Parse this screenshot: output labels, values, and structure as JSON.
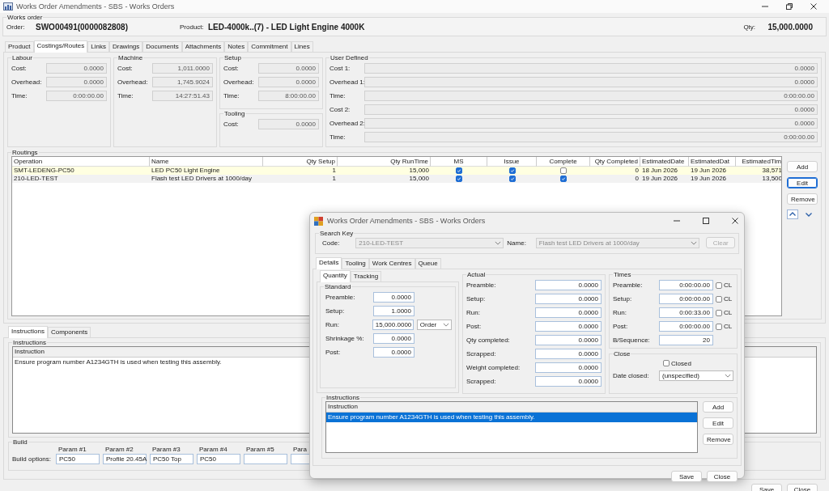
{
  "window": {
    "title": "Works Order Amendments - SBS - Works Orders"
  },
  "works_order": {
    "title": "Works order",
    "order_label": "Order:",
    "order": "SWO00491(0000082808)",
    "product_label": "Product:",
    "product": "LED-4000k..(7) - LED Light Engine 4000K",
    "qty_label": "Qty:",
    "qty": "15,000.0000"
  },
  "tabs": [
    {
      "label": "Product",
      "selected": false
    },
    {
      "label": "Costings/Routes",
      "selected": true
    },
    {
      "label": "Links",
      "selected": false
    },
    {
      "label": "Drawings",
      "selected": false
    },
    {
      "label": "Documents",
      "selected": false
    },
    {
      "label": "Attachments",
      "selected": false
    },
    {
      "label": "Notes",
      "selected": false
    },
    {
      "label": "Commitment",
      "selected": false
    },
    {
      "label": "Lines",
      "selected": false
    }
  ],
  "cost_columns": [
    {
      "groups": [
        {
          "title": "Labour",
          "fields": [
            {
              "label": "Cost:",
              "value": "0.0000"
            },
            {
              "label": "Overhead:",
              "value": "0.0000"
            },
            {
              "label": "Time:",
              "value": "0:00:00.00"
            }
          ]
        }
      ]
    },
    {
      "groups": [
        {
          "title": "Machine",
          "fields": [
            {
              "label": "Cost:",
              "value": "1,011.0000"
            },
            {
              "label": "Overhead:",
              "value": "1,745.9024"
            },
            {
              "label": "Time:",
              "value": "14:27:51.43"
            }
          ]
        }
      ]
    },
    {
      "groups": [
        {
          "title": "Setup",
          "fields": [
            {
              "label": "Cost:",
              "value": "0.0000"
            },
            {
              "label": "Overhead:",
              "value": "0.0000"
            },
            {
              "label": "Time:",
              "value": "8:00:00.00"
            }
          ]
        },
        {
          "title": "Tooling",
          "fields": [
            {
              "label": "Cost:",
              "value": "0.0000"
            }
          ]
        }
      ]
    },
    {
      "groups": [
        {
          "title": "User Defined",
          "fields": [
            {
              "label": "Cost 1:",
              "value": "0.0000"
            },
            {
              "label": "Overhead 1:",
              "value": "0.0000"
            },
            {
              "label": "Time:",
              "value": "0:00:00.00"
            },
            {
              "label": "Cost 2:",
              "value": "0.0000"
            },
            {
              "label": "Overhead 2:",
              "value": "0.0000"
            },
            {
              "label": "Time:",
              "value": "0:00:00.00"
            }
          ]
        }
      ]
    }
  ],
  "routings": {
    "title": "Routings",
    "columns": [
      {
        "label": "Operation",
        "kind": "text"
      },
      {
        "label": "Name",
        "kind": "text"
      },
      {
        "label": "Qty Setup",
        "kind": "number"
      },
      {
        "label": "Qty RunTime",
        "kind": "number"
      },
      {
        "label": "MS",
        "kind": "check"
      },
      {
        "label": "Issue",
        "kind": "check"
      },
      {
        "label": "Complete",
        "kind": "check"
      },
      {
        "label": "Qty Completed",
        "kind": "number"
      },
      {
        "label": "EstimatedDate",
        "kind": "text"
      },
      {
        "label": "EstimatedDat",
        "kind": "text"
      },
      {
        "label": "EstimatedTim",
        "kind": "number"
      }
    ],
    "rows": [
      {
        "selected": true,
        "cells": [
          "SMT-LEDENG-PC50",
          "LED PC50 Light Engine",
          "1",
          "15,000",
          true,
          true,
          false,
          "0",
          "18 Jun 2026",
          "19 Jun 2026",
          "38,571"
        ]
      },
      {
        "selected": false,
        "cells": [
          "210-LED-TEST",
          "Flash test LED Drivers at 1000/day",
          "1",
          "15,000",
          true,
          true,
          true,
          "0",
          "19 Jun 2026",
          "19 Jun 2026",
          "13,500"
        ]
      }
    ],
    "buttons": [
      {
        "label": "Add",
        "focused": false
      },
      {
        "label": "Edit",
        "focused": true
      },
      {
        "label": "Remove",
        "focused": false
      }
    ]
  },
  "lower_tabs": [
    {
      "label": "Instructions",
      "selected": true
    },
    {
      "label": "Components",
      "selected": false
    }
  ],
  "instructions": {
    "title": "Instructions",
    "column": "Instruction",
    "rows": [
      {
        "text": "Ensure program number A1234GTH is used when testing this assembly.",
        "selected": false
      }
    ]
  },
  "build": {
    "title": "Build",
    "label": "Build options:",
    "params": [
      {
        "label": "Param #1",
        "value": "PC50"
      },
      {
        "label": "Param #2",
        "value": "Profile 20.45A"
      },
      {
        "label": "Param #3",
        "value": "PC50 Top"
      },
      {
        "label": "Param #4",
        "value": "PC50"
      },
      {
        "label": "Param #5"
      },
      {
        "label": "Para"
      }
    ]
  },
  "footer_buttons": [
    "Save",
    "Close"
  ],
  "dialog": {
    "title": "Works Order Amendments - SBS - Works Orders",
    "search_key": {
      "title": "Search Key",
      "code_label": "Code:",
      "code": "210-LED-TEST",
      "name_label": "Name:",
      "name": "Flash test LED Drivers at 1000/day",
      "clear": "Clear",
      "clear_disabled": true
    },
    "tabs": [
      {
        "label": "Details",
        "selected": true
      },
      {
        "label": "Tooling",
        "selected": false
      },
      {
        "label": "Work Centres",
        "selected": false
      },
      {
        "label": "Queue",
        "selected": false
      }
    ],
    "subtabs": [
      {
        "label": "Quantity",
        "selected": true
      },
      {
        "label": "Tracking",
        "selected": false
      }
    ],
    "standard": {
      "title": "Standard",
      "fields": [
        {
          "label": "Preamble:",
          "value": "0.0000"
        },
        {
          "label": "Setup:",
          "value": "1.0000"
        },
        {
          "label": "Run:",
          "value": "15,000.0000",
          "unit": "Order"
        },
        {
          "label": "Shrinkage %:",
          "value": "0.0000"
        },
        {
          "label": "Post:",
          "value": "0.0000"
        }
      ]
    },
    "actual": {
      "title": "Actual",
      "fields": [
        {
          "label": "Preamble:",
          "value": "0.0000"
        },
        {
          "label": "Setup:",
          "value": "0.0000"
        },
        {
          "label": "Run:",
          "value": "0.0000"
        },
        {
          "label": "Post:",
          "value": "0.0000"
        },
        {
          "label": "Qty completed:",
          "value": "0.0000"
        },
        {
          "label": "Scrapped:",
          "value": "0.0000"
        },
        {
          "label": "Weight completed:",
          "value": "0.0000"
        },
        {
          "label": "Scrapped:",
          "value": "0.0000"
        }
      ]
    },
    "times": {
      "title": "Times",
      "fields": [
        {
          "label": "Preamble:",
          "value": "0:00:00.00",
          "cl_label": "CL",
          "cl": false
        },
        {
          "label": "Setup:",
          "value": "0:00:00.00",
          "cl_label": "CL",
          "cl": false
        },
        {
          "label": "Run:",
          "value": "0:00:33.00",
          "cl_label": "CL",
          "cl": false
        },
        {
          "label": "Post:",
          "value": "0:00:00.00",
          "cl_label": "CL",
          "cl": false
        },
        {
          "label": "B/Sequence:",
          "value": "20"
        }
      ]
    },
    "close": {
      "title": "Close",
      "closed_label": "Closed",
      "closed": false,
      "date_label": "Date closed:",
      "date": "(unspecified)"
    },
    "instructions": {
      "title": "Instructions",
      "column": "Instruction",
      "rows": [
        {
          "text": "Ensure program number A1234GTH is used when testing this assembly.",
          "selected": true
        }
      ],
      "buttons": [
        "Add",
        "Edit",
        "Remove"
      ]
    },
    "buttons": [
      "Save",
      "Close"
    ]
  }
}
